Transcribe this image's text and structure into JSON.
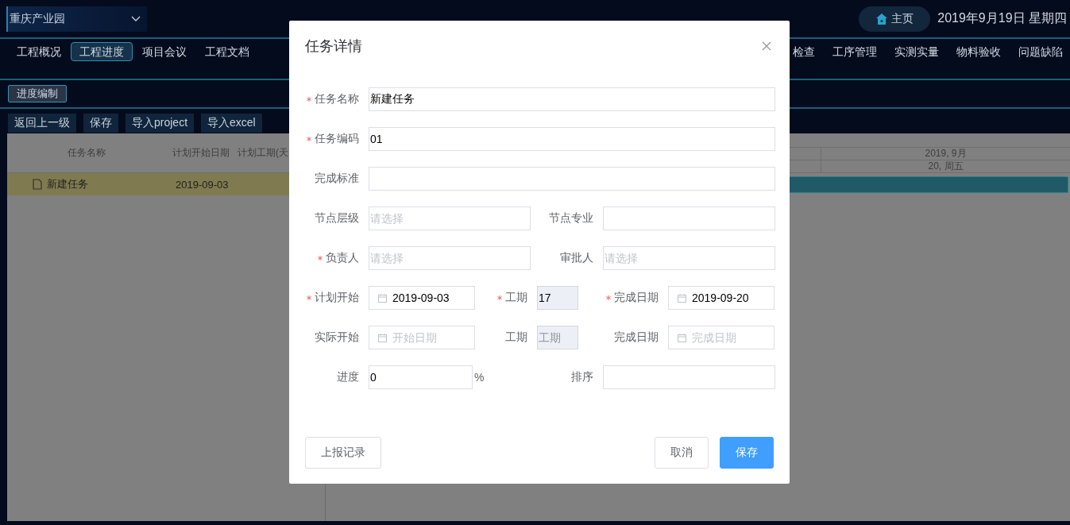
{
  "header": {
    "site_select": "重庆产业园",
    "home_button": "主页",
    "date": "2019年9月19日 星期四"
  },
  "nav_left": [
    {
      "label": "工程概况",
      "selected": false
    },
    {
      "label": "工程进度",
      "selected": true
    },
    {
      "label": "项目会议",
      "selected": false
    },
    {
      "label": "工程文档",
      "selected": false
    }
  ],
  "nav_right": [
    {
      "label": "检查",
      "selected": false
    },
    {
      "label": "工序管理",
      "selected": false
    },
    {
      "label": "实测实量",
      "selected": false
    },
    {
      "label": "物料验收",
      "selected": false
    },
    {
      "label": "问题缺陷",
      "selected": false
    }
  ],
  "sub_tabs": [
    {
      "label": "进度编制",
      "selected": true
    }
  ],
  "toolbar": [
    "返回上一级",
    "保存",
    "导入project",
    "导入excel"
  ],
  "grid": {
    "columns": [
      "任务名称",
      "计划开始日期",
      "计划工期(天"
    ],
    "rows": [
      {
        "name": "新建任务",
        "start": "2019-09-03",
        "selected": true
      }
    ]
  },
  "gantt": {
    "month": "2019, 9月",
    "day": "20, 周五"
  },
  "dialog": {
    "title": "任务详情",
    "form_rows": [
      [
        {
          "label": "任务名称",
          "required": true,
          "kind": "text",
          "value": "新建任务",
          "disabled": false
        }
      ],
      [
        {
          "label": "任务编码",
          "required": true,
          "kind": "text",
          "value": "01",
          "disabled": false
        }
      ],
      [
        {
          "label": "完成标准",
          "required": false,
          "kind": "text",
          "disabled": false
        }
      ],
      [
        {
          "label": "节点层级",
          "required": false,
          "kind": "select",
          "placeholder": "请选择",
          "disabled": false
        },
        {
          "label": "节点专业",
          "required": false,
          "kind": "text",
          "disabled": false
        }
      ],
      [
        {
          "label": "负责人",
          "required": true,
          "kind": "select",
          "placeholder": "请选择",
          "disabled": false
        },
        {
          "label": "审批人",
          "required": false,
          "kind": "select",
          "placeholder": "请选择",
          "disabled": false
        }
      ],
      [
        {
          "label": "计划开始",
          "required": true,
          "kind": "date",
          "value": "2019-09-03",
          "disabled": false
        },
        {
          "label": "工期",
          "required": true,
          "kind": "number",
          "value": "17",
          "disabled": true
        },
        {
          "label": "完成日期",
          "required": true,
          "kind": "date",
          "value": "2019-09-20",
          "disabled": false
        }
      ],
      [
        {
          "label": "实际开始",
          "required": false,
          "kind": "date",
          "placeholder": "开始日期",
          "disabled": false
        },
        {
          "label": "工期",
          "required": false,
          "kind": "number",
          "placeholder": "工期",
          "disabled": true
        },
        {
          "label": "完成日期",
          "required": false,
          "kind": "date",
          "placeholder": "完成日期",
          "disabled": false
        }
      ],
      [
        {
          "label": "进度",
          "required": false,
          "kind": "text",
          "value": "0",
          "suffix": "%",
          "disabled": false
        },
        {
          "label": "排序",
          "required": false,
          "kind": "text",
          "disabled": false
        }
      ]
    ],
    "footer_left": "上报记录",
    "footer_right": [
      {
        "label": "取消",
        "kind": "default"
      },
      {
        "label": "保存",
        "kind": "primary"
      }
    ]
  }
}
